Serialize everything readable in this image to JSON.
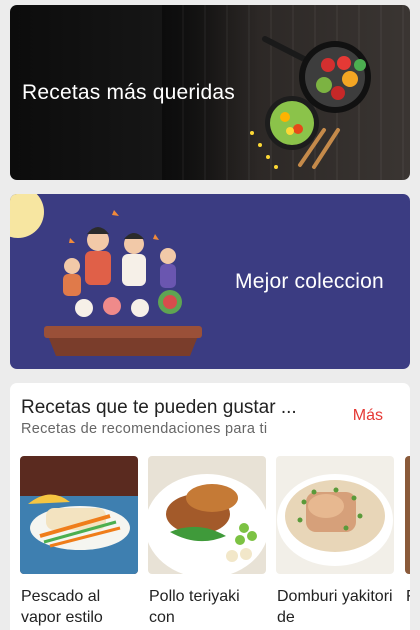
{
  "banners": [
    {
      "title": "Recetas más queridas"
    },
    {
      "title": "Mejor coleccion"
    }
  ],
  "recommendations": {
    "title": "Recetas que te pueden gustar ...",
    "subtitle": "Recetas de recomendaciones para ti",
    "more_label": "Más",
    "items": [
      {
        "name": "Pescado al vapor estilo"
      },
      {
        "name": "Pollo teriyaki con"
      },
      {
        "name": "Domburi yakitori de"
      },
      {
        "name": "F"
      }
    ]
  }
}
